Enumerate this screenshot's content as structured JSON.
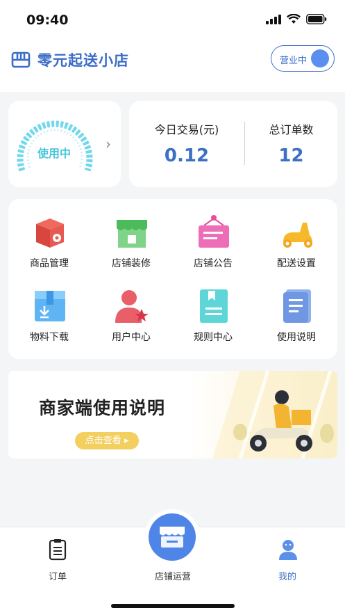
{
  "status_bar": {
    "time": "09:40"
  },
  "header": {
    "store_name": "零元起送小店",
    "status_toggle_label": "营业中"
  },
  "gauge": {
    "label": "使用中"
  },
  "stats": {
    "today_trade": {
      "title": "今日交易(元)",
      "value": "0.12"
    },
    "total_orders": {
      "title": "总订单数",
      "value": "12"
    }
  },
  "menu": {
    "items": [
      {
        "label": "商品管理",
        "icon": "product-box-icon"
      },
      {
        "label": "店铺装修",
        "icon": "storefront-icon"
      },
      {
        "label": "店铺公告",
        "icon": "notice-board-icon"
      },
      {
        "label": "配送设置",
        "icon": "scooter-icon"
      },
      {
        "label": "物料下载",
        "icon": "download-box-icon"
      },
      {
        "label": "用户中心",
        "icon": "user-star-icon"
      },
      {
        "label": "规则中心",
        "icon": "rules-doc-icon"
      },
      {
        "label": "使用说明",
        "icon": "manual-book-icon"
      }
    ]
  },
  "banner": {
    "title": "商家端使用说明",
    "button_label": "点击查看"
  },
  "tabbar": {
    "tabs": [
      {
        "label": "订单"
      },
      {
        "label": "店铺运营"
      },
      {
        "label": "我的"
      }
    ]
  },
  "colors": {
    "accent": "#3d6fc5",
    "gauge": "#47c6dd",
    "banner_button": "#f2cf5e"
  }
}
